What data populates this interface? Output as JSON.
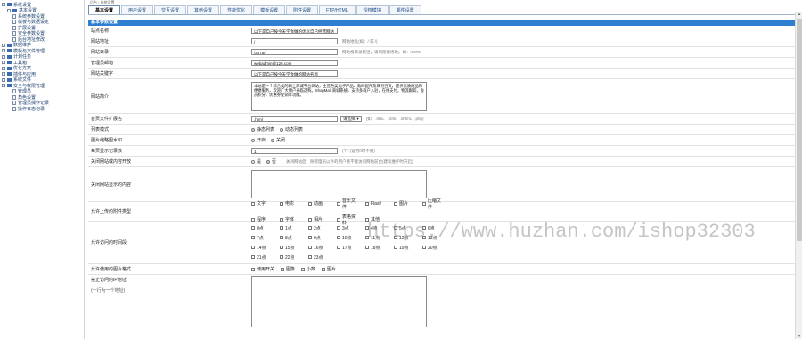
{
  "sidebar": {
    "items": [
      {
        "label": "系统设置",
        "type": "folder"
      },
      {
        "label": "基本设置",
        "type": "folder"
      },
      {
        "label": "系统参数设置",
        "type": "page"
      },
      {
        "label": "模板与数据设定",
        "type": "page"
      },
      {
        "label": "扩展设置",
        "type": "page"
      },
      {
        "label": "安全参数设置",
        "type": "page"
      },
      {
        "label": "后台地址修改",
        "type": "page"
      },
      {
        "label": "数据维护",
        "type": "folder"
      },
      {
        "label": "模板与文件管理",
        "type": "folder"
      },
      {
        "label": "计划任务",
        "type": "folder"
      },
      {
        "label": "工具箱",
        "type": "folder"
      },
      {
        "label": "优化方案",
        "type": "folder"
      },
      {
        "label": "插件与应用",
        "type": "folder"
      },
      {
        "label": "系统文件",
        "type": "folder"
      },
      {
        "label": "安全与权限管理",
        "type": "folder"
      },
      {
        "label": "管理员",
        "type": "page"
      },
      {
        "label": "角色设置",
        "type": "page"
      },
      {
        "label": "管理员操作记录",
        "type": "page"
      },
      {
        "label": "操作日志记录",
        "type": "page"
      }
    ]
  },
  "breadcrumb": "后台 › 系统设置",
  "tabs": [
    "基本设置",
    "用户设置",
    "交互设置",
    "其他设置",
    "性能优化",
    "模板设置",
    "附件设置",
    "FTP/HTML",
    "授权模块",
    "邮件设置"
  ],
  "section_title": "基本参数设置",
  "fields": {
    "site_name": {
      "label": "站点名称",
      "value": "以下是自己按今天学会做的优化自己经营网站"
    },
    "site_url": {
      "label": "网站地址",
      "value": "/",
      "hint": "网站地址(如：/ 或 /)"
    },
    "index_path": {
      "label": "网站目录",
      "value": "/3075/",
      "hint": "网站根目录路径，请勿随意修改。如：/3075/"
    },
    "email": {
      "label": "管理员邮箱",
      "value": "webadmin@126.com"
    },
    "keywords": {
      "label": "网站关键字",
      "value": "以下是自己按今天学会做的网站名称"
    },
    "description": {
      "label": "网站简介",
      "value": "本站是一个综合类的网上商城平台网站，主营各类电子产品、数码配件及日用百货，提供优质商品和便捷服务，欢迎广大用户光临选购。ShopMall 商城系统，支持多商户入驻，在线支付，物流跟踪，会员积分，优惠券促销等功能。"
    },
    "html_ext": {
      "label": "首页文件扩展名",
      "value": ".html",
      "select": "请选择",
      "hint": "(如：.htm、.html、.shtml、.php)"
    },
    "page_mode": {
      "label": "列表模式",
      "options": [
        "静态列表",
        "动态列表"
      ],
      "selected": 0
    },
    "image_compress": {
      "label": "图片缩略图水印",
      "options": [
        "开启",
        "关闭"
      ],
      "selected": 1
    },
    "pagesize": {
      "label": "每页显示记录数",
      "value": "1",
      "hint": "(个) (设为0时不限)"
    },
    "site_close": {
      "label": "关闭网站或内容开放",
      "options": [
        "是",
        "否"
      ],
      "selected": 1,
      "hint": "关闭网站后，除管理员以外的用户将不能访问网站前台(建议维护时开启)"
    },
    "close_reason": {
      "label": "关闭网站显示的内容",
      "value": ""
    },
    "allowed_types": {
      "label": "允许上传的附件类型",
      "options": [
        "文字",
        "电影",
        "动画",
        "音乐文件",
        "Flash",
        "图片",
        "压缩文件",
        "程序",
        "字体",
        "相片",
        "表格资料",
        "其他"
      ]
    },
    "hours": {
      "label": "允许访问的时间段",
      "values": [
        "0点",
        "1点",
        "2点",
        "3点",
        "4点",
        "5点",
        "6点",
        "7点",
        "8点",
        "9点",
        "10点",
        "11点",
        "12点",
        "13点",
        "14点",
        "15点",
        "16点",
        "17点",
        "18点",
        "19点",
        "20点",
        "21点",
        "22点",
        "23点"
      ]
    },
    "image_settings": {
      "label": "允许使用的图片格式",
      "options": [
        "使用开关",
        "图像",
        "小数",
        "图片"
      ]
    },
    "ip_block": {
      "label": "禁止访问的IP地址",
      "note": "(一行为一个地址)",
      "value": ""
    }
  },
  "watermark": "https://www.huzhan.com/ishop32303"
}
